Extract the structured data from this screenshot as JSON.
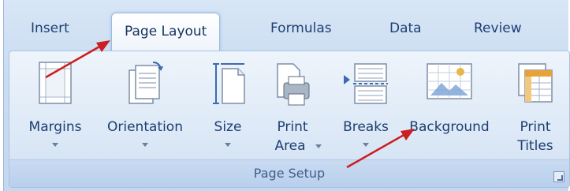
{
  "tabs": [
    "Insert",
    "Page Layout",
    "Formulas",
    "Data",
    "Review"
  ],
  "group": {
    "label": "Page Setup",
    "commands": {
      "margins": "Margins",
      "orientation": "Orientation",
      "size": "Size",
      "print_area_line1": "Print",
      "print_area_line2": "Area",
      "breaks": "Breaks",
      "background": "Background",
      "print_titles_line1": "Print",
      "print_titles_line2": "Titles"
    }
  },
  "colors": {
    "arrow": "#cc1f1f",
    "tab_text": "#1e3f73"
  }
}
